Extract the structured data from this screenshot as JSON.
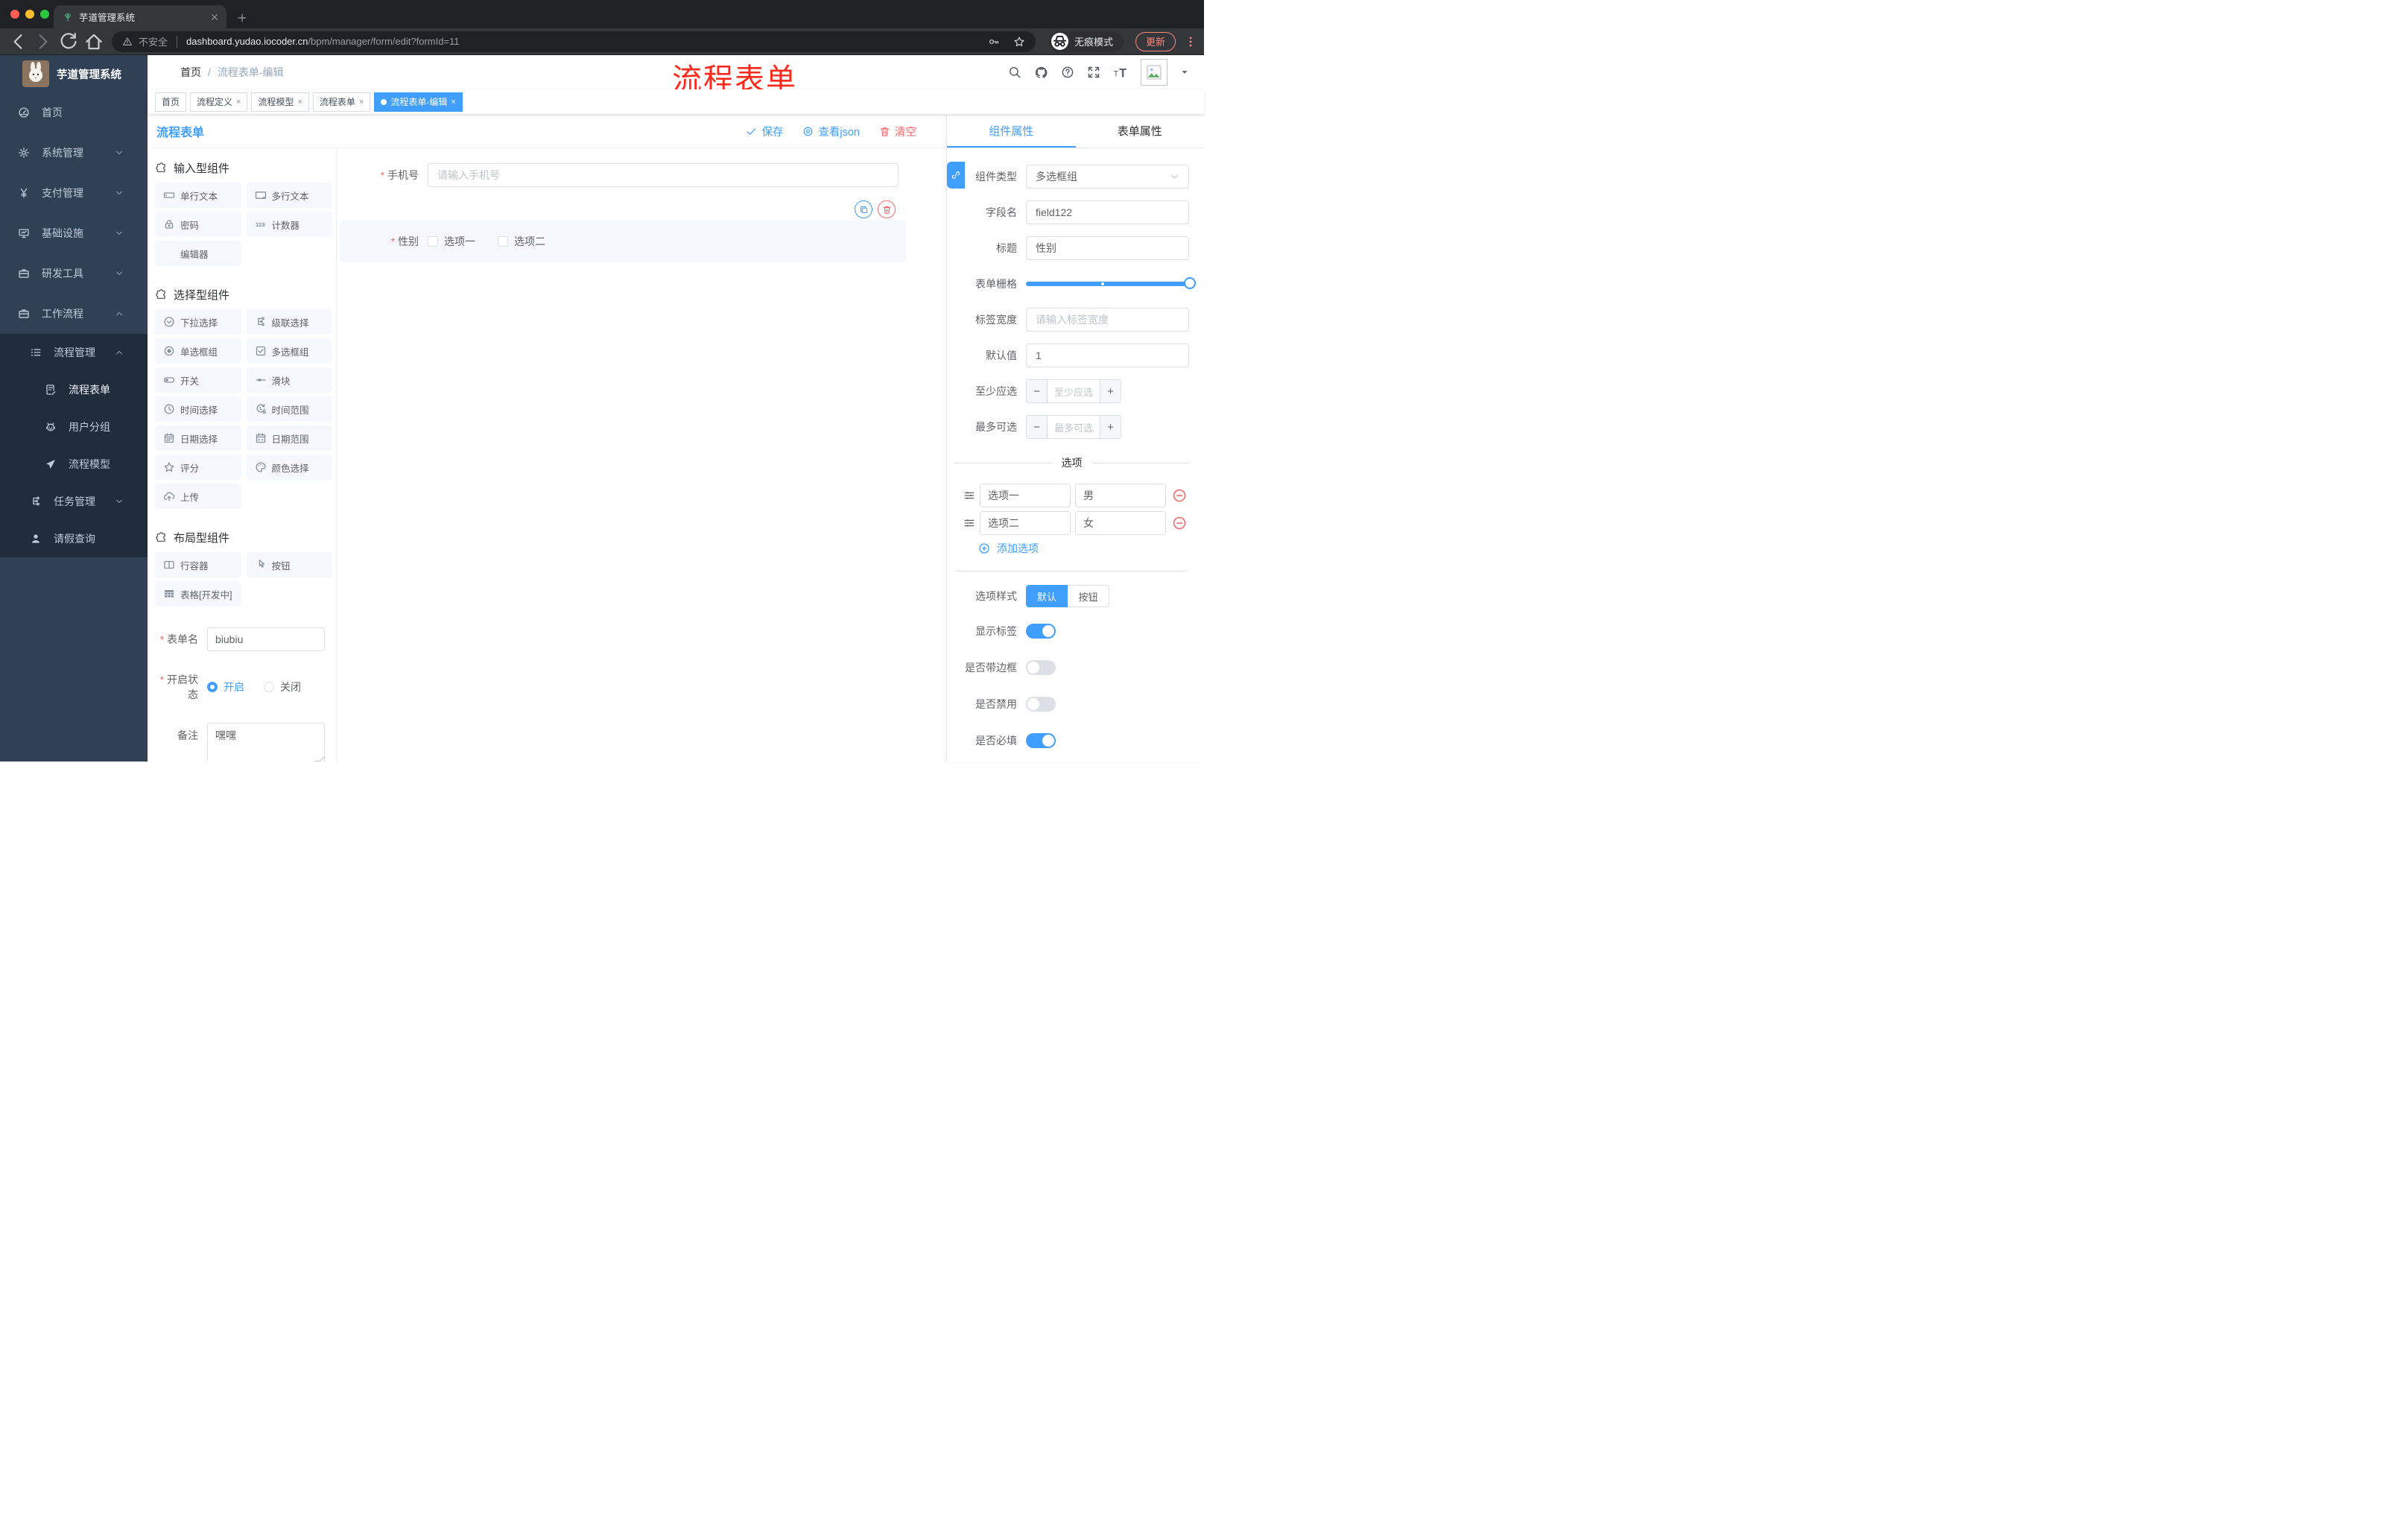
{
  "browser": {
    "tab_title": "芋道管理系统",
    "security_label": "不安全",
    "url_host": "dashboard.yudao.iocoder.cn",
    "url_path": "/bpm/manager/form/edit?formId=11",
    "incognito_label": "无痕模式",
    "update_label": "更新"
  },
  "sidebar": {
    "logo_title": "芋道管理系统",
    "items": [
      {
        "label": "首页",
        "icon": "dashboard-icon",
        "level": 1,
        "dark": false,
        "chevron": ""
      },
      {
        "label": "系统管理",
        "icon": "gear-icon",
        "level": 1,
        "dark": false,
        "chevron": "down"
      },
      {
        "label": "支付管理",
        "icon": "yen-icon",
        "level": 1,
        "dark": false,
        "chevron": "down"
      },
      {
        "label": "基础设施",
        "icon": "monitor-icon",
        "level": 1,
        "dark": false,
        "chevron": "down"
      },
      {
        "label": "研发工具",
        "icon": "briefcase-icon",
        "level": 1,
        "dark": false,
        "chevron": "down"
      },
      {
        "label": "工作流程",
        "icon": "briefcase-icon",
        "level": 1,
        "dark": false,
        "chevron": "up"
      },
      {
        "label": "流程管理",
        "icon": "list-icon",
        "level": 2,
        "dark": true,
        "chevron": "up"
      },
      {
        "label": "流程表单",
        "icon": "form-doc-icon",
        "level": 3,
        "dark": true,
        "chevron": "",
        "active": true
      },
      {
        "label": "用户分组",
        "icon": "robot-icon",
        "level": 3,
        "dark": true,
        "chevron": ""
      },
      {
        "label": "流程模型",
        "icon": "plane-icon",
        "level": 3,
        "dark": true,
        "chevron": ""
      },
      {
        "label": "任务管理",
        "icon": "tree-icon",
        "level": 2,
        "dark": true,
        "chevron": "down"
      },
      {
        "label": "请假查询",
        "icon": "user-icon",
        "level": 2,
        "dark": true,
        "chevron": ""
      }
    ]
  },
  "header": {
    "breadcrumb_home": "首页",
    "breadcrumb_sep": "/",
    "breadcrumb_current": "流程表单-编辑",
    "annotation": "流程表单"
  },
  "tagbar": {
    "tags": [
      {
        "label": "首页",
        "closable": false,
        "active": false
      },
      {
        "label": "流程定义",
        "closable": true,
        "active": false
      },
      {
        "label": "流程模型",
        "closable": true,
        "active": false
      },
      {
        "label": "流程表单",
        "closable": true,
        "active": false
      },
      {
        "label": "流程表单-编辑",
        "closable": true,
        "active": true
      }
    ]
  },
  "designer": {
    "title": "流程表单",
    "actions": [
      {
        "label": "保存",
        "icon": "check-icon",
        "color": "blue"
      },
      {
        "label": "查看json",
        "icon": "eye-icon",
        "color": "blue"
      },
      {
        "label": "清空",
        "icon": "trash-icon",
        "color": "red"
      }
    ],
    "component_groups": [
      {
        "title": "输入型组件",
        "icon": "puzzle-icon",
        "items": [
          {
            "label": "单行文本",
            "icon": "input-icon"
          },
          {
            "label": "多行文本",
            "icon": "textarea-icon"
          },
          {
            "label": "密码",
            "icon": "lock-icon"
          },
          {
            "label": "计数器",
            "icon": "counter-icon"
          },
          {
            "label": "编辑器",
            "icon": ""
          }
        ]
      },
      {
        "title": "选择型组件",
        "icon": "puzzle-icon",
        "items": [
          {
            "label": "下拉选择",
            "icon": "select-icon"
          },
          {
            "label": "级联选择",
            "icon": "cascade-icon"
          },
          {
            "label": "单选框组",
            "icon": "radio-icon"
          },
          {
            "label": "多选框组",
            "icon": "checkbox-icon"
          },
          {
            "label": "开关",
            "icon": "switch-icon"
          },
          {
            "label": "滑块",
            "icon": "slider-icon"
          },
          {
            "label": "时间选择",
            "icon": "time-icon"
          },
          {
            "label": "时间范围",
            "icon": "time-range-icon"
          },
          {
            "label": "日期选择",
            "icon": "date-icon"
          },
          {
            "label": "日期范围",
            "icon": "date-range-icon"
          },
          {
            "label": "评分",
            "icon": "star-icon"
          },
          {
            "label": "颜色选择",
            "icon": "color-icon"
          },
          {
            "label": "上传",
            "icon": "upload-icon"
          }
        ]
      },
      {
        "title": "布局型组件",
        "icon": "puzzle-icon",
        "items": [
          {
            "label": "行容器",
            "icon": "row-icon"
          },
          {
            "label": "按钮",
            "icon": "button-icon"
          },
          {
            "label": "表格[开发中]",
            "icon": "table-icon"
          }
        ]
      }
    ],
    "meta_form": {
      "form_name_label": "表单名",
      "form_name_value": "biubiu",
      "status_label": "开启状态",
      "status_options": [
        {
          "label": "开启",
          "checked": true
        },
        {
          "label": "关闭",
          "checked": false
        }
      ],
      "remark_label": "备注",
      "remark_value": "嘿嘿"
    },
    "canvas": {
      "phone_label": "手机号",
      "phone_placeholder": "请输入手机号",
      "gender_label": "性别",
      "gender_options": [
        {
          "label": "选项一",
          "checked": false
        },
        {
          "label": "选项二",
          "checked": false
        }
      ]
    }
  },
  "properties_panel": {
    "tabs": [
      {
        "label": "组件属性",
        "active": true
      },
      {
        "label": "表单属性",
        "active": false
      }
    ],
    "component_type_label": "组件类型",
    "component_type_value": "多选框组",
    "field_name_label": "字段名",
    "field_name_value": "field122",
    "title_label": "标题",
    "title_value": "性别",
    "grid_label": "表单栅格",
    "grid_value_percent": 100,
    "grid_stop_percent": 46,
    "label_width_label": "标签宽度",
    "label_width_placeholder": "请输入标签宽度",
    "default_value_label": "默认值",
    "default_value": "1",
    "min_select_label": "至少应选",
    "min_select_placeholder": "至少应选",
    "max_select_label": "最多可选",
    "max_select_placeholder": "最多可选",
    "options_divider_label": "选项",
    "options": [
      {
        "label": "选项一",
        "value": "男"
      },
      {
        "label": "选项二",
        "value": "女"
      }
    ],
    "add_option_label": "添加选项",
    "option_style_label": "选项样式",
    "option_style_options": [
      {
        "label": "默认",
        "active": true
      },
      {
        "label": "按钮",
        "active": false
      }
    ],
    "toggles": [
      {
        "label": "显示标签",
        "on": true
      },
      {
        "label": "是否带边框",
        "on": false
      },
      {
        "label": "是否禁用",
        "on": false
      },
      {
        "label": "是否必填",
        "on": true
      }
    ]
  },
  "colors": {
    "accent": "#409EFF",
    "danger": "#F56C6C",
    "annotation_red": "#FC2A1C",
    "sidebar_bg": "#304156",
    "submenu_bg": "#1F2D3D",
    "component_item_bg": "#F6F7FF"
  }
}
